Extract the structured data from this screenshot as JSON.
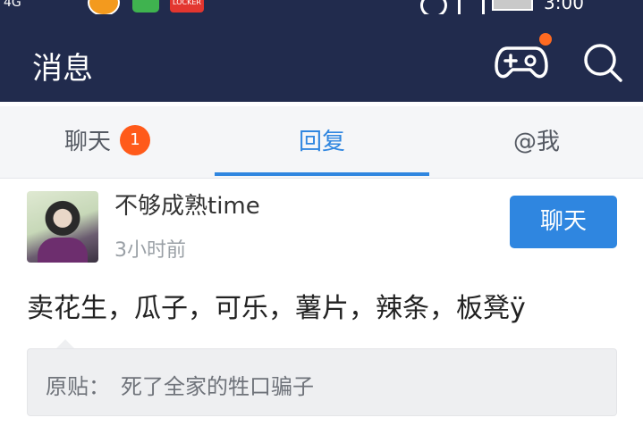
{
  "status_bar": {
    "network": "4G",
    "time": "3:00"
  },
  "header": {
    "title": "消息"
  },
  "tabs": [
    {
      "label": "聊天",
      "badge": "1"
    },
    {
      "label": "回复"
    },
    {
      "label": "@我"
    }
  ],
  "message": {
    "username": "不够成熟time",
    "time_ago": "3小时前",
    "chat_button": "聊天",
    "content": "卖花生，瓜子，可乐，薯片，辣条，板凳ÿ",
    "quote_label": "原贴：",
    "quote_text": "死了全家的牲口骗子"
  },
  "colors": {
    "header_bg": "#212b4d",
    "accent": "#2f86e0",
    "badge": "#ff5a1a"
  }
}
